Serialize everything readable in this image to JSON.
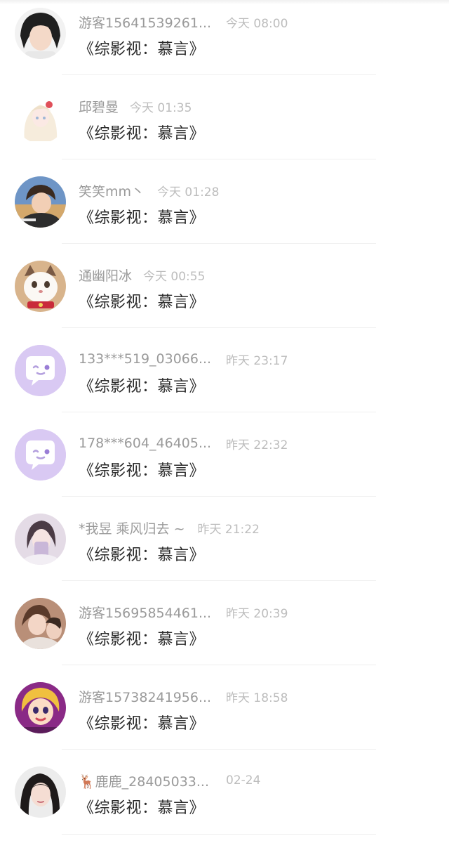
{
  "comments": [
    {
      "name": "游客15641539261...",
      "time": "今天 08:00",
      "title": "《综影视：慕言》",
      "avatar": "user-avatar-photo",
      "avatar_color": "#2b2b2b"
    },
    {
      "name": "邱碧曼",
      "time": "今天 01:35",
      "title": "《综影视：慕言》",
      "avatar": "anime-girl-avatar",
      "avatar_color": "#f3eef2"
    },
    {
      "name": "笑笑mm丶",
      "time": "今天 01:28",
      "title": "《综影视：慕言》",
      "avatar": "user-avatar-photo",
      "avatar_color": "#5a7fb0"
    },
    {
      "name": "通幽阳冰",
      "time": "今天 00:55",
      "title": "《综影视：慕言》",
      "avatar": "cat-avatar",
      "avatar_color": "#e7d9c8"
    },
    {
      "name": "133***519_03066...",
      "time": "昨天 23:17",
      "title": "《综影视：慕言》",
      "avatar": "default-chat-avatar",
      "avatar_color": "#d9c9f3"
    },
    {
      "name": "178***604_46405...",
      "time": "昨天 22:32",
      "title": "《综影视：慕言》",
      "avatar": "default-chat-avatar",
      "avatar_color": "#d9c9f3"
    },
    {
      "name": "*我昱 乘风归去 ~",
      "time": "昨天 21:22",
      "title": "《综影视：慕言》",
      "avatar": "user-avatar-photo",
      "avatar_color": "#d6ccd8"
    },
    {
      "name": "游客15695854461...",
      "time": "昨天 20:39",
      "title": "《综影视：慕言》",
      "avatar": "user-avatar-photo",
      "avatar_color": "#c9a58e"
    },
    {
      "name": "游客15738241956...",
      "time": "昨天 18:58",
      "title": "《综影视：慕言》",
      "avatar": "cartoon-avatar",
      "avatar_color": "#9c2f8a"
    },
    {
      "name": "🦌鹿鹿_28405033...",
      "time": "02-24",
      "title": "《综影视：慕言》",
      "avatar": "user-avatar-photo",
      "avatar_color": "#3a3330"
    }
  ]
}
